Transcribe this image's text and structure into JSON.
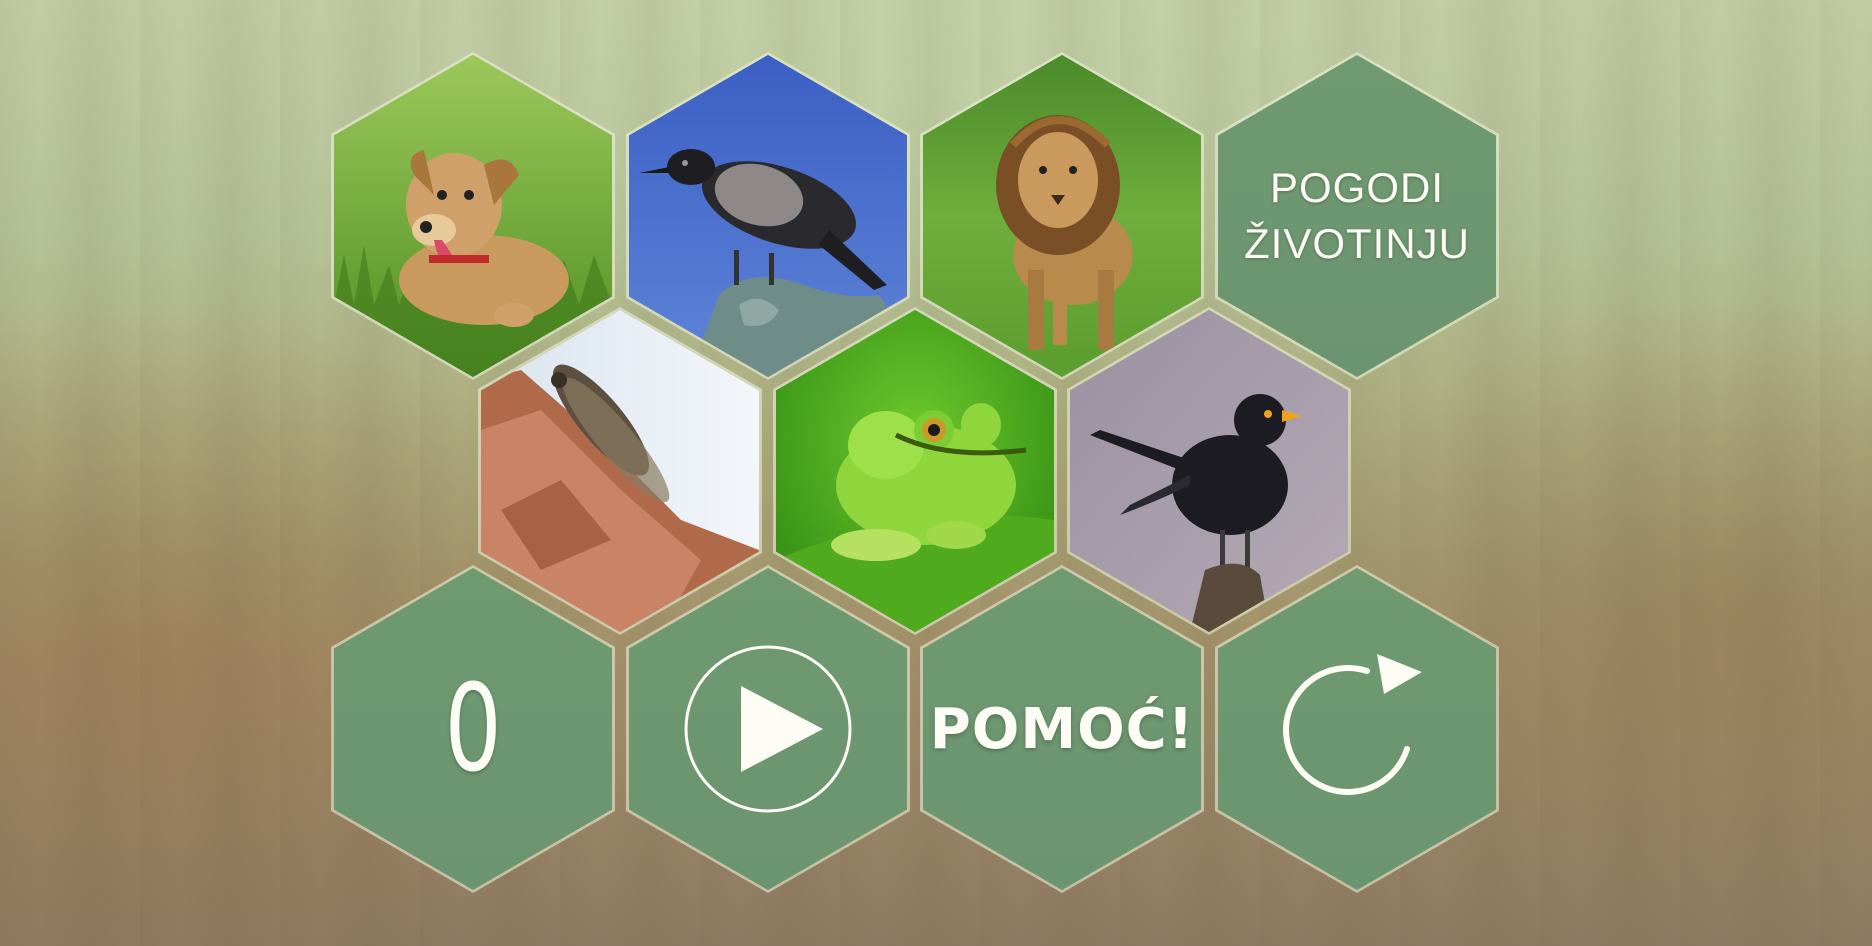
{
  "game": {
    "title_line1": "POGODI",
    "title_line2": "ŽIVOTINJU",
    "score": "0",
    "help_label": "POMOĆ!",
    "play_icon": "play-icon",
    "restart_icon": "restart-icon"
  },
  "tiles": [
    {
      "animal": "dog",
      "icon": "dog-photo"
    },
    {
      "animal": "crow",
      "icon": "crow-photo"
    },
    {
      "animal": "lion",
      "icon": "lion-photo"
    },
    {
      "animal": "cicada",
      "icon": "cicada-photo"
    },
    {
      "animal": "frog",
      "icon": "frog-photo"
    },
    {
      "animal": "blackbird",
      "icon": "blackbird-photo"
    }
  ],
  "colors": {
    "hex_fill": "#6f9a70",
    "text": "#fdfdf5"
  }
}
